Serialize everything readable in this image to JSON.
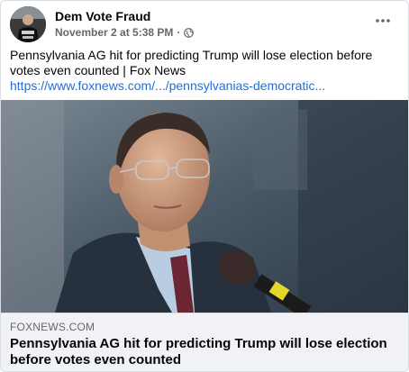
{
  "post": {
    "author": "Dem Vote Fraud",
    "timestamp": "November 2 at 5:38 PM",
    "separator": "·",
    "privacy_icon": "globe-icon",
    "more_icon": "more-options-icon",
    "text": "Pennsylvania AG hit for predicting Trump will lose election before votes even counted | Fox News",
    "link": "https://www.foxnews.com/.../pennsylvanias-democratic..."
  },
  "link_preview": {
    "domain": "FOXNEWS.COM",
    "headline": "Pennsylvania AG hit for predicting Trump will lose election before votes even counted"
  },
  "colors": {
    "link": "#216fdb",
    "secondary_text": "#65676b",
    "footer_bg": "#f0f2f5"
  }
}
